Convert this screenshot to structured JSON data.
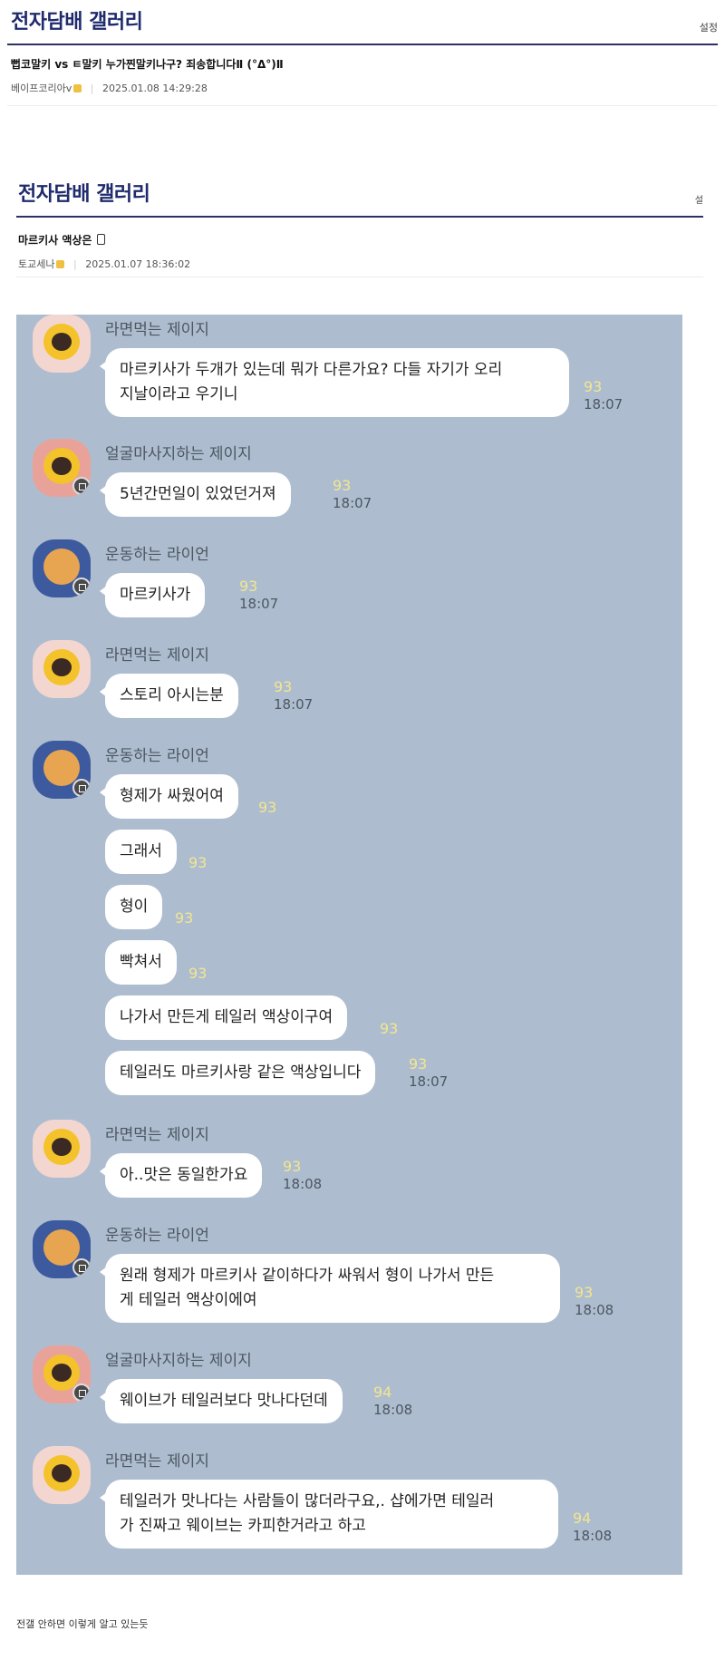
{
  "header1": {
    "title": "전자담배 갤러리",
    "setting": "설정"
  },
  "post1": {
    "title": "뻡코말키 vs ㅌ말키 누가찐말키나구? 죄송합니다Ⅱ (°Δ°)Ⅱ",
    "author": "베이프코리아v",
    "datetime": "2025.01.08 14:29:28"
  },
  "header2": {
    "title": "전자담배 갤러리",
    "setting": "설"
  },
  "post2": {
    "title": "마르키사 액상은",
    "author": "토교세나",
    "datetime": "2025.01.07 18:36:02"
  },
  "chat": {
    "groups": [
      {
        "sender": "라면먹는 제이지",
        "messages": [
          {
            "text": "마르키사가 두개가 있는데 뭐가 다른가요? 다들 자기가 오리\n지날이라고 우기니",
            "count": "93",
            "time": "18:07"
          }
        ]
      },
      {
        "sender": "얼굴마사지하는 제이지",
        "messages": [
          {
            "text": "5년간먼일이 있었던거져",
            "count": "93",
            "time": "18:07"
          }
        ]
      },
      {
        "sender": "운동하는 라이언",
        "messages": [
          {
            "text": "마르키사가",
            "count": "93",
            "time": "18:07"
          }
        ]
      },
      {
        "sender": "라면먹는 제이지",
        "messages": [
          {
            "text": "스토리 아시는분",
            "count": "93",
            "time": "18:07"
          }
        ]
      },
      {
        "sender": "운동하는 라이언",
        "messages": [
          {
            "text": "형제가 싸웠어여",
            "count": "93",
            "time": ""
          },
          {
            "text": "그래서",
            "count": "93",
            "time": ""
          },
          {
            "text": "형이",
            "count": "93",
            "time": ""
          },
          {
            "text": "빡쳐서",
            "count": "93",
            "time": ""
          },
          {
            "text": "나가서 만든게 테일러 액상이구여",
            "count": "93",
            "time": ""
          },
          {
            "text": "테일러도 마르키사랑 같은 액상입니다",
            "count": "93",
            "time": "18:07"
          }
        ]
      },
      {
        "sender": "라면먹는 제이지",
        "messages": [
          {
            "text": "아..맛은 동일한가요",
            "count": "93",
            "time": "18:08"
          }
        ]
      },
      {
        "sender": "운동하는 라이언",
        "messages": [
          {
            "text": "원래 형제가 마르키사 같이하다가 싸워서 형이 나가서 만든\n게 테일러 액상이에여",
            "count": "93",
            "time": "18:08"
          }
        ]
      },
      {
        "sender": "얼굴마사지하는 제이지",
        "messages": [
          {
            "text": "웨이브가 테일러보다 맛나다던데",
            "count": "94",
            "time": "18:08"
          }
        ]
      },
      {
        "sender": "라면먹는 제이지",
        "messages": [
          {
            "text": "테일러가 맛나다는 사람들이 많더라구요,. 샵에가면 테일러\n가 진짜고 웨이브는 카피한거라고 하고",
            "count": "94",
            "time": "18:08"
          }
        ]
      }
    ]
  },
  "caption": "전갤 안하면 이렇게 알고 있는듯",
  "colors": {
    "accent": "#1f2b6c",
    "chat_bg": "#adbdcf",
    "read_count": "#f3e58f"
  }
}
